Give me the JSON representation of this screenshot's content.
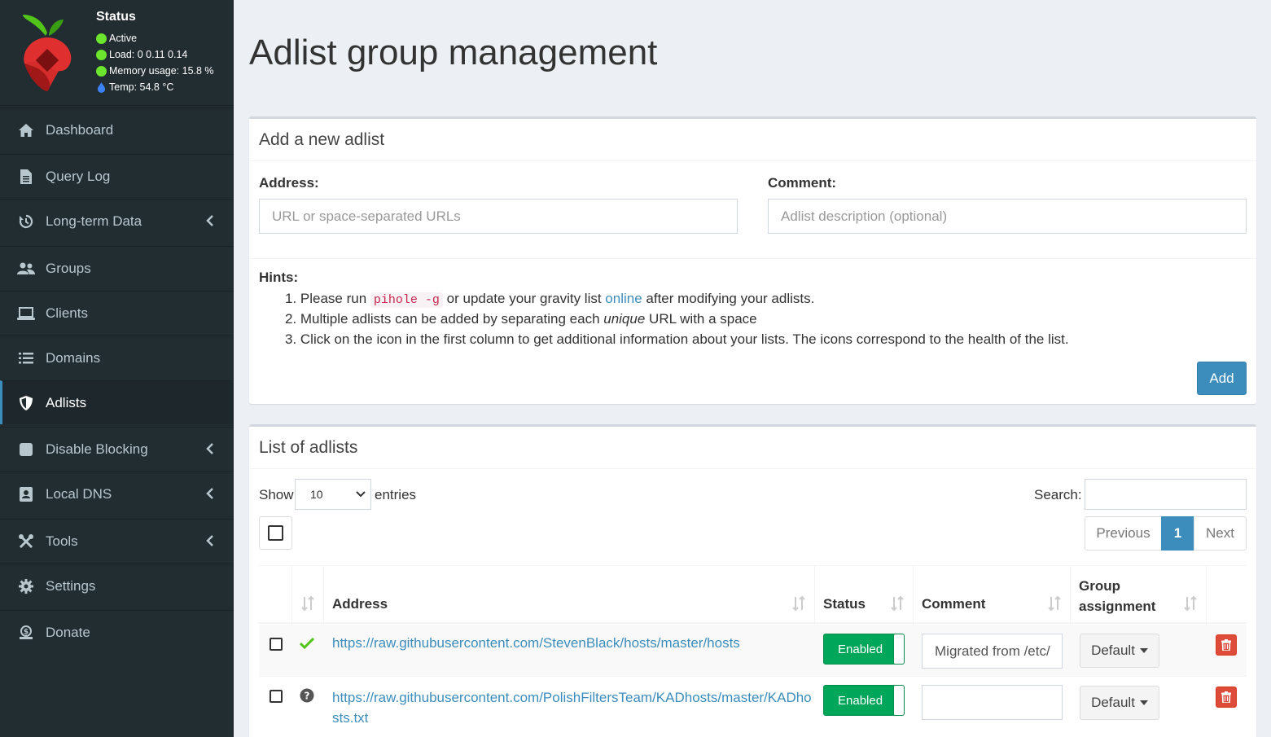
{
  "status": {
    "title": "Status",
    "active": "Active",
    "load": "Load:  0  0.11  0.14",
    "memory": "Memory usage:  15.8 %",
    "temp": "Temp: 54.8 °C"
  },
  "nav": [
    {
      "label": "Dashboard",
      "icon": "home-icon"
    },
    {
      "label": "Query Log",
      "icon": "file-icon"
    },
    {
      "label": "Long-term Data",
      "icon": "history-icon"
    },
    {
      "label": "Groups",
      "icon": "users-icon"
    },
    {
      "label": "Clients",
      "icon": "laptop-icon"
    },
    {
      "label": "Domains",
      "icon": "list-icon"
    },
    {
      "label": "Adlists",
      "icon": "shield-icon"
    },
    {
      "label": "Disable Blocking",
      "icon": "stop-icon"
    },
    {
      "label": "Local DNS",
      "icon": "address-book-icon"
    },
    {
      "label": "Tools",
      "icon": "tools-icon"
    },
    {
      "label": "Settings",
      "icon": "gear-icon"
    },
    {
      "label": "Donate",
      "icon": "donate-icon"
    }
  ],
  "page_title": "Adlist group management",
  "add_box": {
    "title": "Add a new adlist",
    "address_label": "Address:",
    "address_placeholder": "URL or space-separated URLs",
    "comment_label": "Comment:",
    "comment_placeholder": "Adlist description (optional)",
    "hints_title": "Hints:",
    "hint1_pre": "1. Please run ",
    "hint1_code": "pihole -g",
    "hint1_mid": " or update your gravity list ",
    "hint1_link": "online",
    "hint1_post": " after modifying your adlists.",
    "hint2_pre": "2. Multiple adlists can be added by separating each ",
    "hint2_em": "unique",
    "hint2_post": " URL with a space",
    "hint3": "3. Click on the icon in the first column to get additional information about your lists. The icons correspond to the health of the list.",
    "add_button": "Add"
  },
  "list_box": {
    "title": "List of adlists",
    "show_label": "Show",
    "entries_value": "10",
    "entries_label": "entries",
    "search_label": "Search:",
    "pagination": {
      "previous": "Previous",
      "page": "1",
      "next": "Next"
    },
    "columns": {
      "address": "Address",
      "status": "Status",
      "comment": "Comment",
      "group_line1": "Group",
      "group_line2": "assignment"
    },
    "rows": [
      {
        "address": "https://raw.githubusercontent.com/StevenBlack/hosts/master/hosts",
        "address_line2": "",
        "health": "ok",
        "status": "Enabled",
        "comment": "Migrated from /etc/",
        "group": "Default"
      },
      {
        "address": "https://raw.githubusercontent.com/PolishFiltersTeam/KADhosts/master/KADho",
        "address_line2": "sts.txt",
        "health": "unknown",
        "status": "Enabled",
        "comment": "",
        "group": "Default"
      }
    ]
  },
  "colors": {
    "sidebar_bg": "#222d32",
    "accent": "#3c8dbc",
    "success": "#00a65a",
    "danger": "#dd4b39",
    "status_green": "#6be52d"
  }
}
